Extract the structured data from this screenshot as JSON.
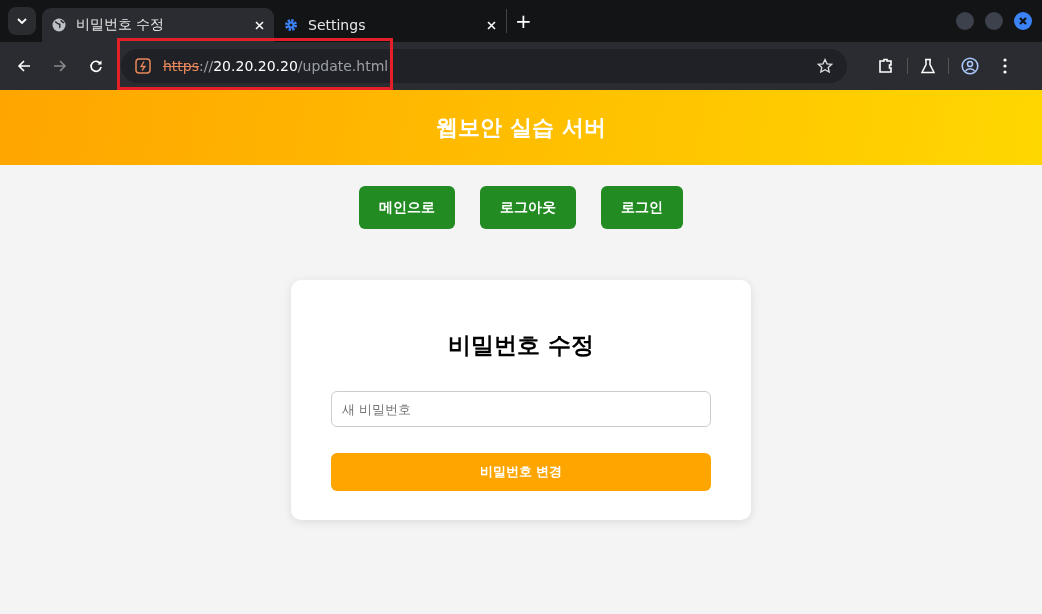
{
  "browser": {
    "tabs": [
      {
        "title": "비밀번호 수정",
        "kind": "globe",
        "selected": true
      },
      {
        "title": "Settings",
        "kind": "gear",
        "selected": false
      }
    ],
    "new_tab": "+",
    "address": {
      "scheme": "https",
      "separator": "://",
      "host": "20.20.20.20",
      "path": "/update.html",
      "secure": false,
      "highlighted": true
    }
  },
  "site_title": "웹보안 실습 서버",
  "nav_buttons": [
    "메인으로",
    "로그아웃",
    "로그인"
  ],
  "card": {
    "heading": "비밀번호 수정",
    "password_field": {
      "placeholder": "새 비밀번호"
    },
    "submit_button": "비밀번호 변경"
  }
}
